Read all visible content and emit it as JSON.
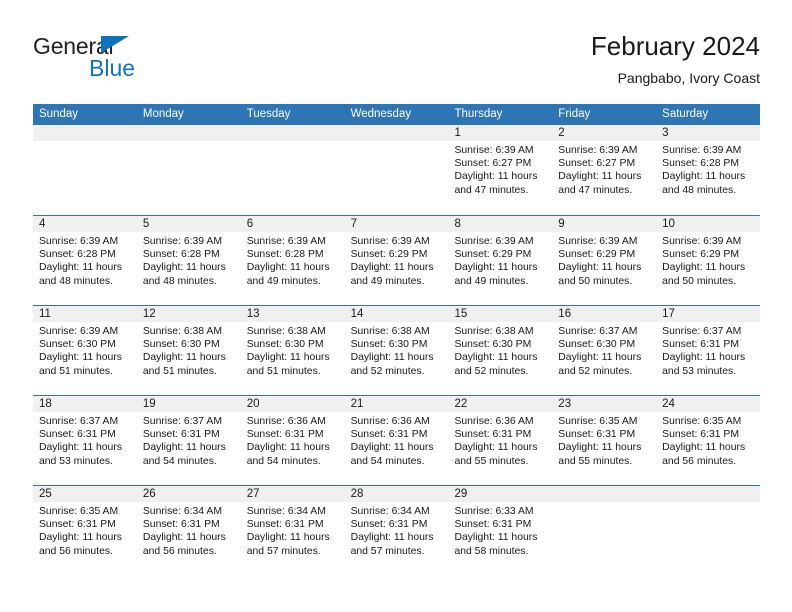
{
  "brand": {
    "name_part1": "General",
    "name_part2": "Blue",
    "accent_color": "#1273bd"
  },
  "header": {
    "title": "February 2024",
    "subtitle": "Pangbabo, Ivory Coast",
    "header_bg_color": "#2e75b6",
    "daynum_bg_color": "#f0f0f0"
  },
  "weekdays": [
    "Sunday",
    "Monday",
    "Tuesday",
    "Wednesday",
    "Thursday",
    "Friday",
    "Saturday"
  ],
  "weeks": [
    {
      "days": [
        {
          "num": "",
          "sunrise": "",
          "sunset": "",
          "daylight1": "",
          "daylight2": ""
        },
        {
          "num": "",
          "sunrise": "",
          "sunset": "",
          "daylight1": "",
          "daylight2": ""
        },
        {
          "num": "",
          "sunrise": "",
          "sunset": "",
          "daylight1": "",
          "daylight2": ""
        },
        {
          "num": "",
          "sunrise": "",
          "sunset": "",
          "daylight1": "",
          "daylight2": ""
        },
        {
          "num": "1",
          "sunrise": "Sunrise: 6:39 AM",
          "sunset": "Sunset: 6:27 PM",
          "daylight1": "Daylight: 11 hours",
          "daylight2": "and 47 minutes."
        },
        {
          "num": "2",
          "sunrise": "Sunrise: 6:39 AM",
          "sunset": "Sunset: 6:27 PM",
          "daylight1": "Daylight: 11 hours",
          "daylight2": "and 47 minutes."
        },
        {
          "num": "3",
          "sunrise": "Sunrise: 6:39 AM",
          "sunset": "Sunset: 6:28 PM",
          "daylight1": "Daylight: 11 hours",
          "daylight2": "and 48 minutes."
        }
      ]
    },
    {
      "days": [
        {
          "num": "4",
          "sunrise": "Sunrise: 6:39 AM",
          "sunset": "Sunset: 6:28 PM",
          "daylight1": "Daylight: 11 hours",
          "daylight2": "and 48 minutes."
        },
        {
          "num": "5",
          "sunrise": "Sunrise: 6:39 AM",
          "sunset": "Sunset: 6:28 PM",
          "daylight1": "Daylight: 11 hours",
          "daylight2": "and 48 minutes."
        },
        {
          "num": "6",
          "sunrise": "Sunrise: 6:39 AM",
          "sunset": "Sunset: 6:28 PM",
          "daylight1": "Daylight: 11 hours",
          "daylight2": "and 49 minutes."
        },
        {
          "num": "7",
          "sunrise": "Sunrise: 6:39 AM",
          "sunset": "Sunset: 6:29 PM",
          "daylight1": "Daylight: 11 hours",
          "daylight2": "and 49 minutes."
        },
        {
          "num": "8",
          "sunrise": "Sunrise: 6:39 AM",
          "sunset": "Sunset: 6:29 PM",
          "daylight1": "Daylight: 11 hours",
          "daylight2": "and 49 minutes."
        },
        {
          "num": "9",
          "sunrise": "Sunrise: 6:39 AM",
          "sunset": "Sunset: 6:29 PM",
          "daylight1": "Daylight: 11 hours",
          "daylight2": "and 50 minutes."
        },
        {
          "num": "10",
          "sunrise": "Sunrise: 6:39 AM",
          "sunset": "Sunset: 6:29 PM",
          "daylight1": "Daylight: 11 hours",
          "daylight2": "and 50 minutes."
        }
      ]
    },
    {
      "days": [
        {
          "num": "11",
          "sunrise": "Sunrise: 6:39 AM",
          "sunset": "Sunset: 6:30 PM",
          "daylight1": "Daylight: 11 hours",
          "daylight2": "and 51 minutes."
        },
        {
          "num": "12",
          "sunrise": "Sunrise: 6:38 AM",
          "sunset": "Sunset: 6:30 PM",
          "daylight1": "Daylight: 11 hours",
          "daylight2": "and 51 minutes."
        },
        {
          "num": "13",
          "sunrise": "Sunrise: 6:38 AM",
          "sunset": "Sunset: 6:30 PM",
          "daylight1": "Daylight: 11 hours",
          "daylight2": "and 51 minutes."
        },
        {
          "num": "14",
          "sunrise": "Sunrise: 6:38 AM",
          "sunset": "Sunset: 6:30 PM",
          "daylight1": "Daylight: 11 hours",
          "daylight2": "and 52 minutes."
        },
        {
          "num": "15",
          "sunrise": "Sunrise: 6:38 AM",
          "sunset": "Sunset: 6:30 PM",
          "daylight1": "Daylight: 11 hours",
          "daylight2": "and 52 minutes."
        },
        {
          "num": "16",
          "sunrise": "Sunrise: 6:37 AM",
          "sunset": "Sunset: 6:30 PM",
          "daylight1": "Daylight: 11 hours",
          "daylight2": "and 52 minutes."
        },
        {
          "num": "17",
          "sunrise": "Sunrise: 6:37 AM",
          "sunset": "Sunset: 6:31 PM",
          "daylight1": "Daylight: 11 hours",
          "daylight2": "and 53 minutes."
        }
      ]
    },
    {
      "days": [
        {
          "num": "18",
          "sunrise": "Sunrise: 6:37 AM",
          "sunset": "Sunset: 6:31 PM",
          "daylight1": "Daylight: 11 hours",
          "daylight2": "and 53 minutes."
        },
        {
          "num": "19",
          "sunrise": "Sunrise: 6:37 AM",
          "sunset": "Sunset: 6:31 PM",
          "daylight1": "Daylight: 11 hours",
          "daylight2": "and 54 minutes."
        },
        {
          "num": "20",
          "sunrise": "Sunrise: 6:36 AM",
          "sunset": "Sunset: 6:31 PM",
          "daylight1": "Daylight: 11 hours",
          "daylight2": "and 54 minutes."
        },
        {
          "num": "21",
          "sunrise": "Sunrise: 6:36 AM",
          "sunset": "Sunset: 6:31 PM",
          "daylight1": "Daylight: 11 hours",
          "daylight2": "and 54 minutes."
        },
        {
          "num": "22",
          "sunrise": "Sunrise: 6:36 AM",
          "sunset": "Sunset: 6:31 PM",
          "daylight1": "Daylight: 11 hours",
          "daylight2": "and 55 minutes."
        },
        {
          "num": "23",
          "sunrise": "Sunrise: 6:35 AM",
          "sunset": "Sunset: 6:31 PM",
          "daylight1": "Daylight: 11 hours",
          "daylight2": "and 55 minutes."
        },
        {
          "num": "24",
          "sunrise": "Sunrise: 6:35 AM",
          "sunset": "Sunset: 6:31 PM",
          "daylight1": "Daylight: 11 hours",
          "daylight2": "and 56 minutes."
        }
      ]
    },
    {
      "days": [
        {
          "num": "25",
          "sunrise": "Sunrise: 6:35 AM",
          "sunset": "Sunset: 6:31 PM",
          "daylight1": "Daylight: 11 hours",
          "daylight2": "and 56 minutes."
        },
        {
          "num": "26",
          "sunrise": "Sunrise: 6:34 AM",
          "sunset": "Sunset: 6:31 PM",
          "daylight1": "Daylight: 11 hours",
          "daylight2": "and 56 minutes."
        },
        {
          "num": "27",
          "sunrise": "Sunrise: 6:34 AM",
          "sunset": "Sunset: 6:31 PM",
          "daylight1": "Daylight: 11 hours",
          "daylight2": "and 57 minutes."
        },
        {
          "num": "28",
          "sunrise": "Sunrise: 6:34 AM",
          "sunset": "Sunset: 6:31 PM",
          "daylight1": "Daylight: 11 hours",
          "daylight2": "and 57 minutes."
        },
        {
          "num": "29",
          "sunrise": "Sunrise: 6:33 AM",
          "sunset": "Sunset: 6:31 PM",
          "daylight1": "Daylight: 11 hours",
          "daylight2": "and 58 minutes."
        },
        {
          "num": "",
          "sunrise": "",
          "sunset": "",
          "daylight1": "",
          "daylight2": ""
        },
        {
          "num": "",
          "sunrise": "",
          "sunset": "",
          "daylight1": "",
          "daylight2": ""
        }
      ]
    }
  ]
}
